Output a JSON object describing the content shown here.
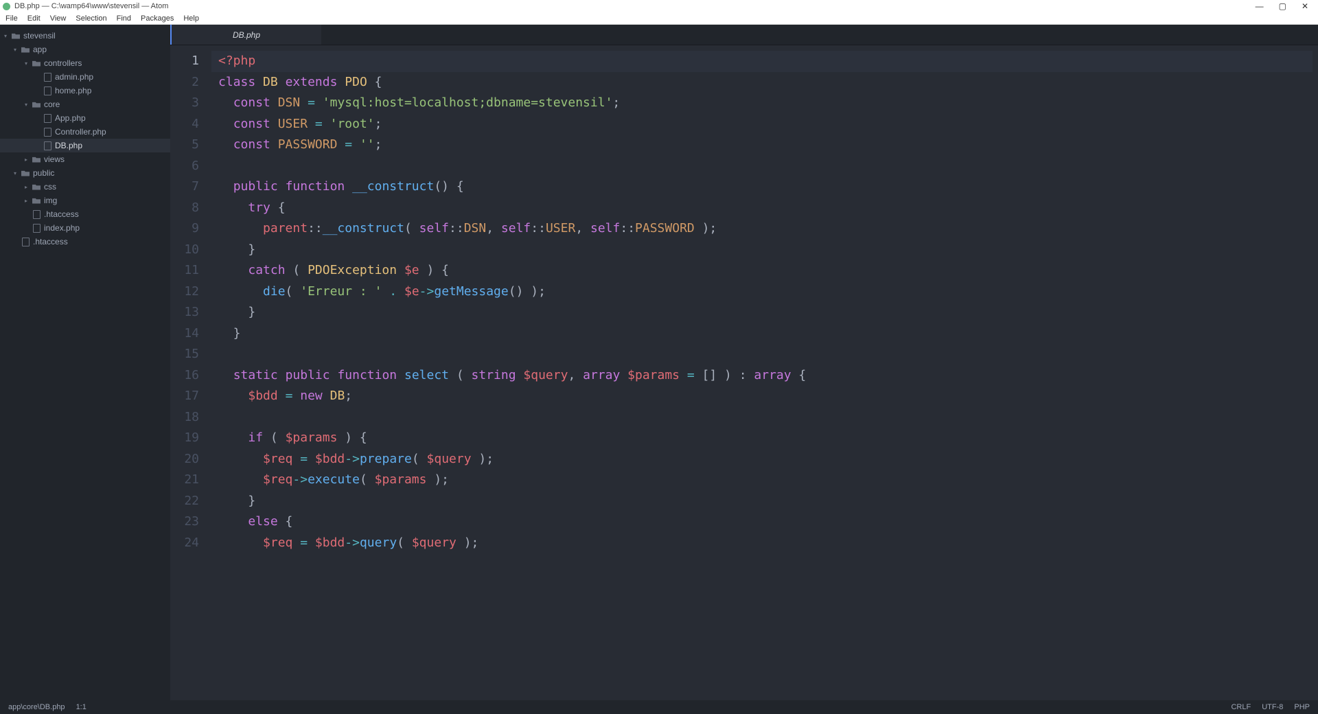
{
  "window": {
    "title": "DB.php — C:\\wamp64\\www\\stevensil — Atom"
  },
  "menu": [
    "File",
    "Edit",
    "View",
    "Selection",
    "Find",
    "Packages",
    "Help"
  ],
  "win_controls": {
    "min": "—",
    "max": "▢",
    "close": "✕"
  },
  "tree": [
    {
      "label": "stevensil",
      "type": "folder",
      "indent": 0,
      "arrow": "▾"
    },
    {
      "label": "app",
      "type": "folder",
      "indent": 1,
      "arrow": "▾"
    },
    {
      "label": "controllers",
      "type": "folder",
      "indent": 2,
      "arrow": "▾"
    },
    {
      "label": "admin.php",
      "type": "file",
      "indent": 3
    },
    {
      "label": "home.php",
      "type": "file",
      "indent": 3
    },
    {
      "label": "core",
      "type": "folder",
      "indent": 2,
      "arrow": "▾"
    },
    {
      "label": "App.php",
      "type": "file",
      "indent": 3
    },
    {
      "label": "Controller.php",
      "type": "file",
      "indent": 3
    },
    {
      "label": "DB.php",
      "type": "file",
      "indent": 3,
      "active": true
    },
    {
      "label": "views",
      "type": "folder",
      "indent": 2,
      "arrow": "▸"
    },
    {
      "label": "public",
      "type": "folder",
      "indent": 1,
      "arrow": "▾"
    },
    {
      "label": "css",
      "type": "folder",
      "indent": 2,
      "arrow": "▸"
    },
    {
      "label": "img",
      "type": "folder",
      "indent": 2,
      "arrow": "▸"
    },
    {
      "label": ".htaccess",
      "type": "file",
      "indent": 2
    },
    {
      "label": "index.php",
      "type": "file",
      "indent": 2
    },
    {
      "label": ".htaccess",
      "type": "file",
      "indent": 1
    }
  ],
  "tabs": [
    {
      "label": "DB.php",
      "active": true
    }
  ],
  "code_lines": [
    [
      {
        "c": "tag",
        "t": "<?php"
      }
    ],
    [
      {
        "c": "kw",
        "t": "class"
      },
      {
        "c": "pun",
        "t": " "
      },
      {
        "c": "cls",
        "t": "DB"
      },
      {
        "c": "pun",
        "t": " "
      },
      {
        "c": "kw",
        "t": "extends"
      },
      {
        "c": "pun",
        "t": " "
      },
      {
        "c": "cls",
        "t": "PDO"
      },
      {
        "c": "pun",
        "t": " {"
      }
    ],
    [
      {
        "c": "pun",
        "t": "  "
      },
      {
        "c": "kw",
        "t": "const"
      },
      {
        "c": "pun",
        "t": " "
      },
      {
        "c": "con",
        "t": "DSN"
      },
      {
        "c": "pun",
        "t": " "
      },
      {
        "c": "op",
        "t": "="
      },
      {
        "c": "pun",
        "t": " "
      },
      {
        "c": "str",
        "t": "'mysql:host=localhost;dbname=stevensil'"
      },
      {
        "c": "pun",
        "t": ";"
      }
    ],
    [
      {
        "c": "pun",
        "t": "  "
      },
      {
        "c": "kw",
        "t": "const"
      },
      {
        "c": "pun",
        "t": " "
      },
      {
        "c": "con",
        "t": "USER"
      },
      {
        "c": "pun",
        "t": " "
      },
      {
        "c": "op",
        "t": "="
      },
      {
        "c": "pun",
        "t": " "
      },
      {
        "c": "str",
        "t": "'root'"
      },
      {
        "c": "pun",
        "t": ";"
      }
    ],
    [
      {
        "c": "pun",
        "t": "  "
      },
      {
        "c": "kw",
        "t": "const"
      },
      {
        "c": "pun",
        "t": " "
      },
      {
        "c": "con",
        "t": "PASSWORD"
      },
      {
        "c": "pun",
        "t": " "
      },
      {
        "c": "op",
        "t": "="
      },
      {
        "c": "pun",
        "t": " "
      },
      {
        "c": "str",
        "t": "''"
      },
      {
        "c": "pun",
        "t": ";"
      }
    ],
    [],
    [
      {
        "c": "pun",
        "t": "  "
      },
      {
        "c": "kw",
        "t": "public"
      },
      {
        "c": "pun",
        "t": " "
      },
      {
        "c": "kw",
        "t": "function"
      },
      {
        "c": "pun",
        "t": " "
      },
      {
        "c": "fn",
        "t": "__construct"
      },
      {
        "c": "pun",
        "t": "() {"
      }
    ],
    [
      {
        "c": "pun",
        "t": "    "
      },
      {
        "c": "kw",
        "t": "try"
      },
      {
        "c": "pun",
        "t": " {"
      }
    ],
    [
      {
        "c": "pun",
        "t": "      "
      },
      {
        "c": "var",
        "t": "parent"
      },
      {
        "c": "pun",
        "t": "::"
      },
      {
        "c": "fn",
        "t": "__construct"
      },
      {
        "c": "pun",
        "t": "( "
      },
      {
        "c": "kw",
        "t": "self"
      },
      {
        "c": "pun",
        "t": "::"
      },
      {
        "c": "con",
        "t": "DSN"
      },
      {
        "c": "pun",
        "t": ", "
      },
      {
        "c": "kw",
        "t": "self"
      },
      {
        "c": "pun",
        "t": "::"
      },
      {
        "c": "con",
        "t": "USER"
      },
      {
        "c": "pun",
        "t": ", "
      },
      {
        "c": "kw",
        "t": "self"
      },
      {
        "c": "pun",
        "t": "::"
      },
      {
        "c": "con",
        "t": "PASSWORD"
      },
      {
        "c": "pun",
        "t": " );"
      }
    ],
    [
      {
        "c": "pun",
        "t": "    }"
      }
    ],
    [
      {
        "c": "pun",
        "t": "    "
      },
      {
        "c": "kw",
        "t": "catch"
      },
      {
        "c": "pun",
        "t": " ( "
      },
      {
        "c": "cls",
        "t": "PDOException"
      },
      {
        "c": "pun",
        "t": " "
      },
      {
        "c": "var",
        "t": "$e"
      },
      {
        "c": "pun",
        "t": " ) {"
      }
    ],
    [
      {
        "c": "pun",
        "t": "      "
      },
      {
        "c": "fn",
        "t": "die"
      },
      {
        "c": "pun",
        "t": "( "
      },
      {
        "c": "str",
        "t": "'Erreur : '"
      },
      {
        "c": "pun",
        "t": " "
      },
      {
        "c": "op",
        "t": "."
      },
      {
        "c": "pun",
        "t": " "
      },
      {
        "c": "var",
        "t": "$e"
      },
      {
        "c": "op",
        "t": "->"
      },
      {
        "c": "fn",
        "t": "getMessage"
      },
      {
        "c": "pun",
        "t": "() );"
      }
    ],
    [
      {
        "c": "pun",
        "t": "    }"
      }
    ],
    [
      {
        "c": "pun",
        "t": "  }"
      }
    ],
    [],
    [
      {
        "c": "pun",
        "t": "  "
      },
      {
        "c": "kw",
        "t": "static"
      },
      {
        "c": "pun",
        "t": " "
      },
      {
        "c": "kw",
        "t": "public"
      },
      {
        "c": "pun",
        "t": " "
      },
      {
        "c": "kw",
        "t": "function"
      },
      {
        "c": "pun",
        "t": " "
      },
      {
        "c": "fn",
        "t": "select"
      },
      {
        "c": "pun",
        "t": " ( "
      },
      {
        "c": "kw",
        "t": "string"
      },
      {
        "c": "pun",
        "t": " "
      },
      {
        "c": "var",
        "t": "$query"
      },
      {
        "c": "pun",
        "t": ", "
      },
      {
        "c": "kw",
        "t": "array"
      },
      {
        "c": "pun",
        "t": " "
      },
      {
        "c": "var",
        "t": "$params"
      },
      {
        "c": "pun",
        "t": " "
      },
      {
        "c": "op",
        "t": "="
      },
      {
        "c": "pun",
        "t": " [] ) : "
      },
      {
        "c": "kw",
        "t": "array"
      },
      {
        "c": "pun",
        "t": " {"
      }
    ],
    [
      {
        "c": "pun",
        "t": "    "
      },
      {
        "c": "var",
        "t": "$bdd"
      },
      {
        "c": "pun",
        "t": " "
      },
      {
        "c": "op",
        "t": "="
      },
      {
        "c": "pun",
        "t": " "
      },
      {
        "c": "kw",
        "t": "new"
      },
      {
        "c": "pun",
        "t": " "
      },
      {
        "c": "cls",
        "t": "DB"
      },
      {
        "c": "pun",
        "t": ";"
      }
    ],
    [],
    [
      {
        "c": "pun",
        "t": "    "
      },
      {
        "c": "kw",
        "t": "if"
      },
      {
        "c": "pun",
        "t": " ( "
      },
      {
        "c": "var",
        "t": "$params"
      },
      {
        "c": "pun",
        "t": " ) {"
      }
    ],
    [
      {
        "c": "pun",
        "t": "      "
      },
      {
        "c": "var",
        "t": "$req"
      },
      {
        "c": "pun",
        "t": " "
      },
      {
        "c": "op",
        "t": "="
      },
      {
        "c": "pun",
        "t": " "
      },
      {
        "c": "var",
        "t": "$bdd"
      },
      {
        "c": "op",
        "t": "->"
      },
      {
        "c": "fn",
        "t": "prepare"
      },
      {
        "c": "pun",
        "t": "( "
      },
      {
        "c": "var",
        "t": "$query"
      },
      {
        "c": "pun",
        "t": " );"
      }
    ],
    [
      {
        "c": "pun",
        "t": "      "
      },
      {
        "c": "var",
        "t": "$req"
      },
      {
        "c": "op",
        "t": "->"
      },
      {
        "c": "fn",
        "t": "execute"
      },
      {
        "c": "pun",
        "t": "( "
      },
      {
        "c": "var",
        "t": "$params"
      },
      {
        "c": "pun",
        "t": " );"
      }
    ],
    [
      {
        "c": "pun",
        "t": "    }"
      }
    ],
    [
      {
        "c": "pun",
        "t": "    "
      },
      {
        "c": "kw",
        "t": "else"
      },
      {
        "c": "pun",
        "t": " {"
      }
    ],
    [
      {
        "c": "pun",
        "t": "      "
      },
      {
        "c": "var",
        "t": "$req"
      },
      {
        "c": "pun",
        "t": " "
      },
      {
        "c": "op",
        "t": "="
      },
      {
        "c": "pun",
        "t": " "
      },
      {
        "c": "var",
        "t": "$bdd"
      },
      {
        "c": "op",
        "t": "->"
      },
      {
        "c": "fn",
        "t": "query"
      },
      {
        "c": "pun",
        "t": "( "
      },
      {
        "c": "var",
        "t": "$query"
      },
      {
        "c": "pun",
        "t": " );"
      }
    ]
  ],
  "current_line": 1,
  "status": {
    "path": "app\\core\\DB.php",
    "pos": "1:1",
    "eol": "CRLF",
    "enc": "UTF-8",
    "lang": "PHP"
  }
}
